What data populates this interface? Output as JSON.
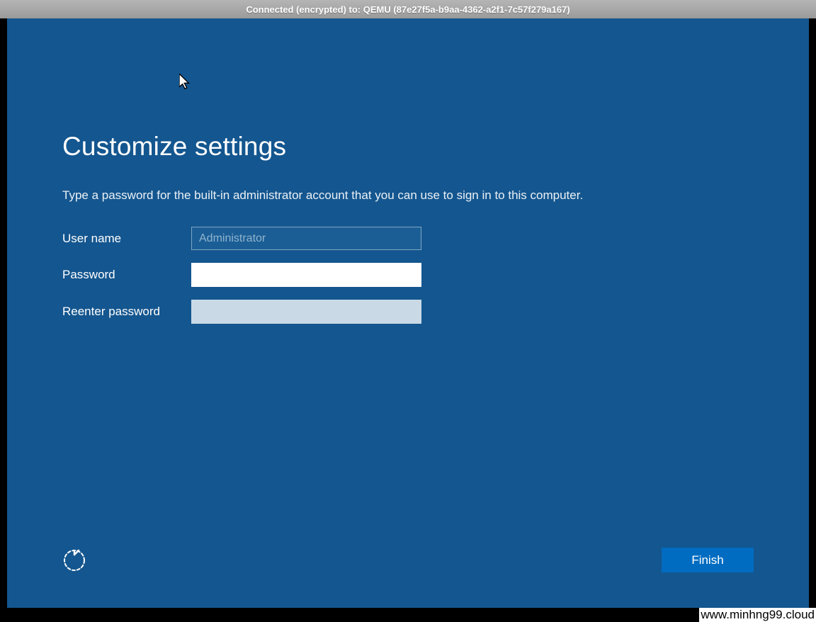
{
  "vnc": {
    "title": "Connected (encrypted) to: QEMU (87e27f5a-b9aa-4362-a2f1-7c57f279a167)"
  },
  "setup": {
    "title": "Customize settings",
    "instruction": "Type a password for the built-in administrator account that you can use to sign in to this computer.",
    "fields": {
      "username_label": "User name",
      "username_value": "Administrator",
      "password_label": "Password",
      "password_value": "",
      "reenter_label": "Reenter password",
      "reenter_value": ""
    },
    "finish_label": "Finish"
  },
  "watermark": "www.minhng99.cloud"
}
